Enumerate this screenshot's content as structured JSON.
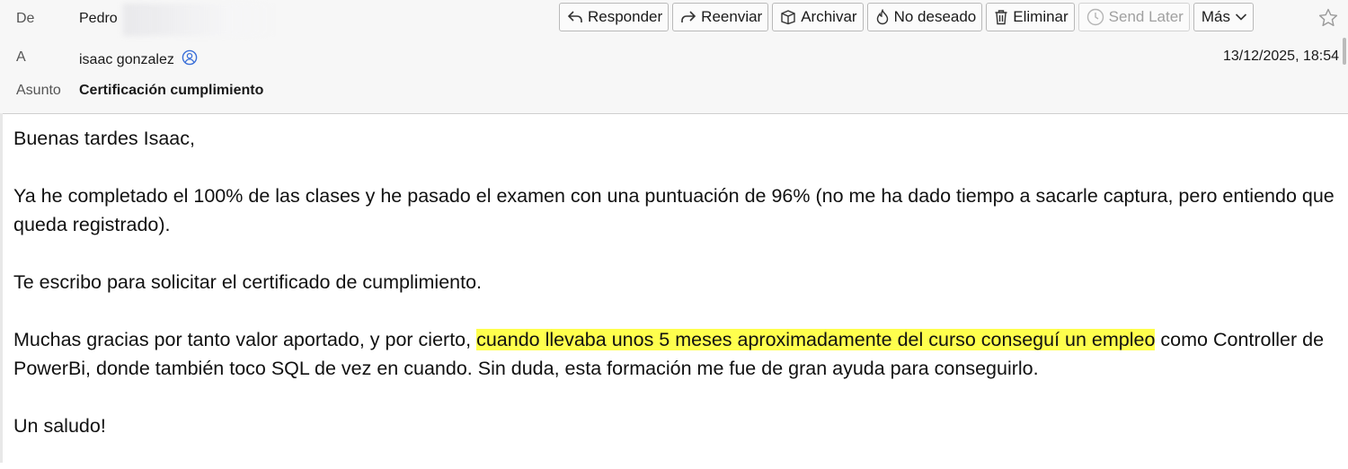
{
  "header": {
    "from_label": "De",
    "from_value": "Pedro",
    "to_label": "A",
    "to_value": "isaac gonzalez",
    "subject_label": "Asunto",
    "subject_value": "Certificación cumplimiento",
    "date": "13/12/2025, 18:54"
  },
  "toolbar": {
    "reply": "Responder",
    "forward": "Reenviar",
    "archive": "Archivar",
    "junk": "No deseado",
    "delete": "Eliminar",
    "send_later": "Send Later",
    "more": "Más"
  },
  "message": {
    "greeting": "Buenas tardes Isaac,",
    "para1": "Ya he completado el 100% de las clases y he pasado el examen con una puntuación de 96% (no me ha dado tiempo a sacarle captura, pero entiendo que queda registrado).",
    "para2": "Te escribo para solicitar el certificado de cumplimiento.",
    "para3_before": "Muchas gracias por tanto valor aportado, y por cierto, ",
    "para3_highlight": "cuando llevaba unos 5 meses aproximadamente del curso conseguí un empleo",
    "para3_after": " como Controller de PowerBi, donde también toco SQL de vez en cuando. Sin duda, esta formación me fue de gran ayuda para conseguirlo.",
    "closing": "Un saludo!",
    "highlight_color": "#ffff4d"
  },
  "icons": {
    "reply": "reply-icon",
    "forward": "forward-icon",
    "archive": "archive-icon",
    "junk": "flame-icon",
    "delete": "trash-icon",
    "send_later": "clock-icon",
    "more": "chevron-down-icon",
    "star": "star-icon",
    "contact": "contact-icon"
  }
}
